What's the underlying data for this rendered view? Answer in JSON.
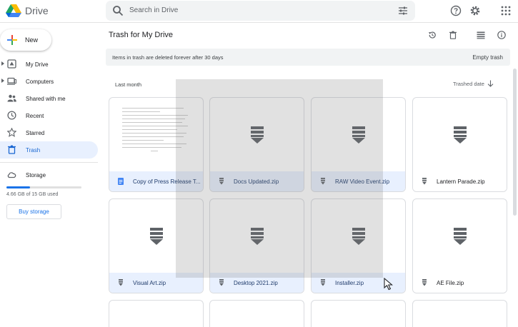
{
  "app": {
    "name": "Drive"
  },
  "search": {
    "placeholder": "Search in Drive"
  },
  "header_icons": [
    "support-icon",
    "settings-icon",
    "apps-grid-icon"
  ],
  "sidebar": {
    "new_label": "New",
    "items": [
      {
        "label": "My Drive",
        "icon": "my-drive-icon",
        "expandable": true,
        "active": false
      },
      {
        "label": "Computers",
        "icon": "computers-icon",
        "expandable": true,
        "active": false
      },
      {
        "label": "Shared with me",
        "icon": "shared-icon",
        "expandable": false,
        "active": false
      },
      {
        "label": "Recent",
        "icon": "clock-icon",
        "expandable": false,
        "active": false
      },
      {
        "label": "Starred",
        "icon": "star-icon",
        "expandable": false,
        "active": false
      },
      {
        "label": "Trash",
        "icon": "trash-icon",
        "expandable": false,
        "active": true
      }
    ],
    "storage_label": "Storage",
    "storage_used": "4.66 GB of 15 GB used",
    "storage_fraction": 0.31,
    "buy_storage": "Buy storage"
  },
  "main": {
    "title": "Trash for My Drive",
    "toolbar_icons": [
      "restore-icon",
      "delete-forever-icon",
      "list-view-icon",
      "info-icon"
    ],
    "notice": "Items in trash are deleted forever after 30 days",
    "empty_trash": "Empty trash",
    "section": "Last month",
    "sort_label": "Trashed date",
    "files": [
      {
        "name": "Copy of Press Release T...",
        "type": "doc"
      },
      {
        "name": "Docs Updated.zip",
        "type": "zip"
      },
      {
        "name": "RAW Video Event.zip",
        "type": "zip"
      },
      {
        "name": "Lantern Parade.zip",
        "type": "zip"
      },
      {
        "name": "Visual Art.zip",
        "type": "zip"
      },
      {
        "name": "Desktop 2021.zip",
        "type": "zip"
      },
      {
        "name": "Installer.zip",
        "type": "zip"
      },
      {
        "name": "AE File.zip",
        "type": "zip"
      }
    ]
  },
  "colors": {
    "accent": "#1a73e8",
    "active_bg": "#e8f0fe",
    "selection_overlay": "#787878"
  }
}
